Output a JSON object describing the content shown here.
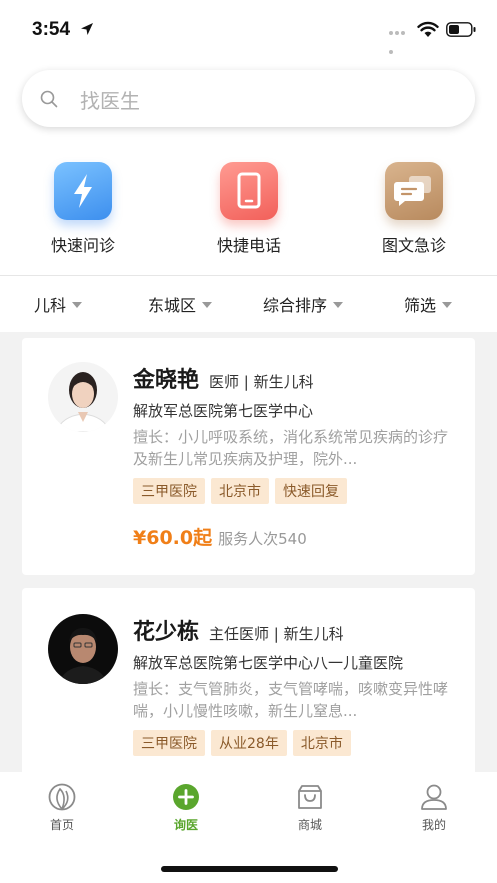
{
  "status_bar": {
    "time": "3:54"
  },
  "search": {
    "placeholder": "找医生"
  },
  "quick_actions": [
    {
      "label": "快速问诊",
      "icon": "lightning-icon",
      "color": "#4a9af2"
    },
    {
      "label": "快捷电话",
      "icon": "phone-icon",
      "color": "#f46a62"
    },
    {
      "label": "图文急诊",
      "icon": "chat-bubbles-icon",
      "color": "#c39469"
    }
  ],
  "filters": [
    {
      "label": "儿科"
    },
    {
      "label": "东城区"
    },
    {
      "label": "综合排序"
    },
    {
      "label": "筛选"
    }
  ],
  "doctors": [
    {
      "name": "金晓艳",
      "title": "医师 | 新生儿科",
      "hospital": "解放军总医院第七医学中心",
      "expertise": "擅长：小儿呼吸系统，消化系统常见疾病的诊疗及新生儿常见疾病及护理，院外...",
      "tags": [
        "三甲医院",
        "北京市",
        "快速回复"
      ],
      "price": "¥60.0起",
      "served": "服务人次540"
    },
    {
      "name": "花少栋",
      "title": "主任医师 | 新生儿科",
      "hospital": "解放军总医院第七医学中心八一儿童医院",
      "expertise": "擅长：支气管肺炎，支气管哮喘，咳嗽变异性哮喘，小儿慢性咳嗽，新生儿窒息...",
      "tags": [
        "三甲医院",
        "从业28年",
        "北京市"
      ]
    }
  ],
  "tab_bar": {
    "items": [
      {
        "label": "首页",
        "icon": "home-leaf-icon"
      },
      {
        "label": "询医",
        "icon": "add-circle-icon",
        "active": true
      },
      {
        "label": "商城",
        "icon": "shopping-bag-icon"
      },
      {
        "label": "我的",
        "icon": "profile-icon"
      }
    ]
  },
  "colors": {
    "accent": "#5aa62d",
    "price": "#f07f18",
    "tag_bg": "#fbe8d2"
  }
}
